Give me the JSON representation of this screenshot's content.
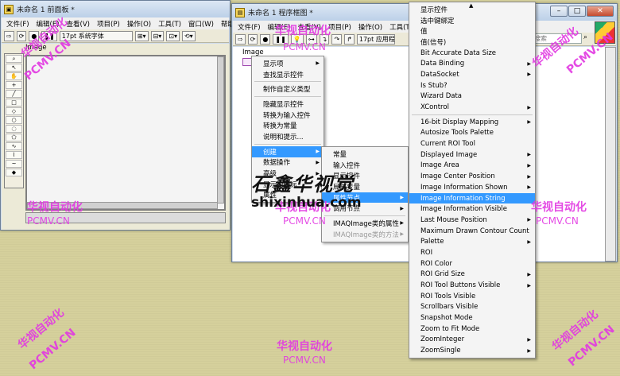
{
  "front_panel": {
    "title": "未命名 1 前面板 *",
    "menu": [
      "文件(F)",
      "编辑(E)",
      "查看(V)",
      "项目(P)",
      "操作(O)",
      "工具(T)",
      "窗口(W)",
      "帮助(H)"
    ],
    "font_selector": "17pt 系统字体",
    "control_label": "Image"
  },
  "block_diagram": {
    "title": "未命名 1 程序框图 *",
    "menu": [
      "文件(F)",
      "编辑(E)",
      "查看(V)",
      "项目(P)",
      "操作(O)",
      "工具(T)"
    ],
    "font_selector": "17pt 应用程",
    "search_placeholder": "搜索",
    "terminal_label": "Image"
  },
  "context_menu": {
    "items": [
      {
        "label": "显示项",
        "arrow": true
      },
      {
        "label": "查找显示控件"
      },
      {
        "sep": true
      },
      {
        "label": "制作自定义类型"
      },
      {
        "sep": true
      },
      {
        "label": "隐藏显示控件"
      },
      {
        "label": "转换为输入控件"
      },
      {
        "label": "转换为常量"
      },
      {
        "label": "说明和提示..."
      },
      {
        "sep": true
      },
      {
        "label": "创建",
        "arrow": true,
        "selected": true
      },
      {
        "label": "数据操作",
        "arrow": true
      },
      {
        "label": "高级",
        "arrow": true
      },
      {
        "label": "显示为图标"
      },
      {
        "label": "属性"
      }
    ]
  },
  "create_submenu": {
    "items": [
      {
        "label": "常量"
      },
      {
        "label": "输入控件"
      },
      {
        "label": "显示控件"
      },
      {
        "label": "局部变量"
      },
      {
        "label": "属性节点",
        "arrow": true,
        "selected": true
      },
      {
        "label": "调用节点",
        "arrow": true
      },
      {
        "sep": true
      },
      {
        "label": "IMAQImage类的属性",
        "arrow": true
      },
      {
        "label": "IMAQImage类的方法",
        "arrow": true,
        "disabled": true
      }
    ]
  },
  "property_submenu": {
    "items": [
      {
        "label": "显示控件"
      },
      {
        "label": "选中键绑定"
      },
      {
        "label": "值"
      },
      {
        "label": "值(信号)"
      },
      {
        "label": "Bit Accurate Data Size"
      },
      {
        "label": "Data Binding",
        "arrow": true
      },
      {
        "label": "DataSocket",
        "arrow": true
      },
      {
        "label": "Is Stub?"
      },
      {
        "label": "Wizard Data"
      },
      {
        "label": "XControl",
        "arrow": true
      },
      {
        "sep": true
      },
      {
        "label": "16-bit Display Mapping",
        "arrow": true
      },
      {
        "label": "Autosize Tools Palette"
      },
      {
        "label": "Current ROI Tool"
      },
      {
        "label": "Displayed Image",
        "arrow": true
      },
      {
        "label": "Image Area",
        "arrow": true
      },
      {
        "label": "Image Center Position",
        "arrow": true
      },
      {
        "label": "Image Information Shown",
        "arrow": true
      },
      {
        "label": "Image Information String",
        "selected": true
      },
      {
        "label": "Image Information Visible"
      },
      {
        "label": "Last Mouse Position",
        "arrow": true
      },
      {
        "label": "Maximum Drawn Contour Count"
      },
      {
        "label": "Palette",
        "arrow": true
      },
      {
        "label": "ROI"
      },
      {
        "label": "ROI Color"
      },
      {
        "label": "ROI Grid Size",
        "arrow": true
      },
      {
        "label": "ROI Tool Buttons Visible",
        "arrow": true
      },
      {
        "label": "ROI Tools Visible"
      },
      {
        "label": "Scrollbars Visible"
      },
      {
        "label": "Snapshot Mode"
      },
      {
        "label": "Zoom to Fit Mode"
      },
      {
        "label": "ZoomInteger",
        "arrow": true
      },
      {
        "label": "ZoomSingle",
        "arrow": true
      }
    ]
  },
  "watermarks": {
    "cn": "华视自动化",
    "en": "PCMV.CN",
    "site": "shixinhua.com",
    "logo": "石鑫华视觉"
  },
  "colors": {
    "selection": "#3399ff",
    "watermark": "#e238e2",
    "desktop": "#d5d09c"
  }
}
